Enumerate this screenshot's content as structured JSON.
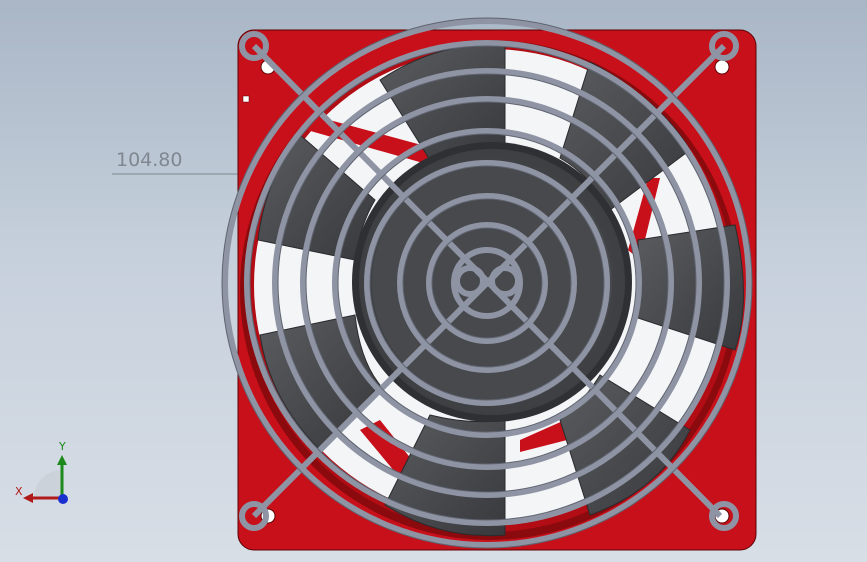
{
  "viewport": {
    "dimension_value": "104.80",
    "triad": {
      "y_label": "Y",
      "x_label": "X"
    }
  },
  "colors": {
    "background_top": "#a9b6c6",
    "housing_red": "#c8101a",
    "housing_dark": "#8a0a0e",
    "blade_gray": "#4a4c50",
    "grille_gray": "#8e94a4",
    "dimension_gray": "#7f8790"
  },
  "icons": {
    "triad": "coordinate-triad-icon"
  }
}
